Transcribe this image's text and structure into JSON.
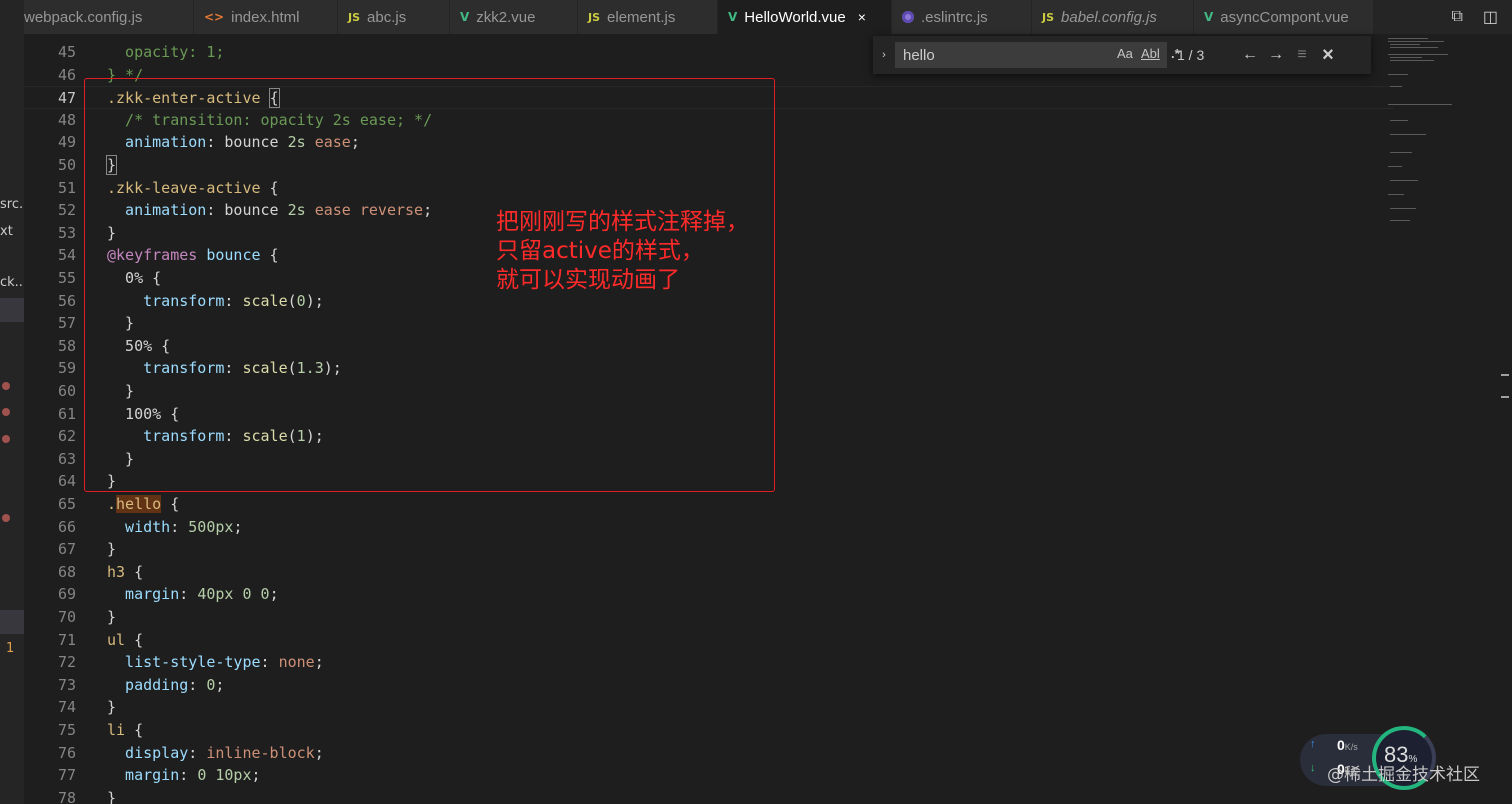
{
  "tabs": [
    {
      "label": "webpack.config.js",
      "icon": "js-icon",
      "active": false,
      "italic": false
    },
    {
      "label": "index.html",
      "icon": "html-icon",
      "active": false,
      "italic": false
    },
    {
      "label": "abc.js",
      "icon": "js-icon",
      "active": false,
      "italic": false
    },
    {
      "label": "zkk2.vue",
      "icon": "vue-icon",
      "active": false,
      "italic": false
    },
    {
      "label": "element.js",
      "icon": "js-icon",
      "active": false,
      "italic": false
    },
    {
      "label": "HelloWorld.vue",
      "icon": "vue-icon",
      "active": true,
      "italic": false
    },
    {
      "label": ".eslintrc.js",
      "icon": "eslint-icon",
      "active": false,
      "italic": false
    },
    {
      "label": "babel.config.js",
      "icon": "js-icon",
      "active": false,
      "italic": true
    },
    {
      "label": "asyncCompont.vue",
      "icon": "vue-icon",
      "active": false,
      "italic": false
    }
  ],
  "icons": {
    "js": "JS",
    "html": "<>",
    "vue": "V",
    "close": "×",
    "compare": "⧉",
    "split": "◫"
  },
  "sidebar": {
    "snippets": [
      "src...",
      "xt",
      "ck..."
    ],
    "badge": "1"
  },
  "find": {
    "query": "hello",
    "match_case": "Aa",
    "whole_word": "Abl",
    "regex": ".*",
    "count": "1 / 3",
    "prev": "←",
    "next": "→",
    "selection": "≡",
    "close": "×",
    "toggle": "›"
  },
  "annotation": {
    "lines": [
      "把刚刚写的样式注释掉，",
      "只留active的样式，",
      "就可以实现动画了"
    ],
    "color": "#ff2a2a"
  },
  "code": {
    "line_numbers": [
      "45",
      "46",
      "47",
      "48",
      "49",
      "50",
      "51",
      "52",
      "53",
      "54",
      "55",
      "56",
      "57",
      "58",
      "59",
      "60",
      "61",
      "62",
      "63",
      "64",
      "65",
      "66",
      "67",
      "68",
      "69",
      "70",
      "71",
      "72",
      "73",
      "74",
      "75",
      "76",
      "77",
      "78"
    ],
    "current_line": "47",
    "t": {
      "l45a": "  opacity: 1;",
      "l46a": "} */",
      "l47a": ".zkk-enter-active",
      "l47b": " ",
      "l47c": "{",
      "l48a": "  /* transition: opacity 2s ease; */",
      "l49a": "  animation",
      "l49b": ": bounce ",
      "l49c": "2s",
      "l49d": " ease",
      "l49e": ";",
      "l50a": "}",
      "l51a": ".zkk-leave-active",
      "l51b": " {",
      "l52a": "  animation",
      "l52b": ": bounce ",
      "l52c": "2s",
      "l52d": " ease reverse",
      "l52e": ";",
      "l53a": "}",
      "l54a": "@keyframes",
      "l54b": " bounce",
      "l54c": " {",
      "l55a": "  0%",
      "l55b": " {",
      "l56a": "    transform",
      "l56b": ": ",
      "l56c": "scale",
      "l56d": "(",
      "l56e": "0",
      "l56f": ");",
      "l57a": "  }",
      "l58a": "  50%",
      "l58b": " {",
      "l59a": "    transform",
      "l59b": ": ",
      "l59c": "scale",
      "l59d": "(",
      "l59e": "1.3",
      "l59f": ");",
      "l60a": "  }",
      "l61a": "  100%",
      "l61b": " {",
      "l62a": "    transform",
      "l62b": ": ",
      "l62c": "scale",
      "l62d": "(",
      "l62e": "1",
      "l62f": ");",
      "l63a": "  }",
      "l64a": "}",
      "l65a": ".",
      "l65b": "hello",
      "l65c": " {",
      "l66a": "  width",
      "l66b": ": ",
      "l66c": "500px",
      "l66d": ";",
      "l67a": "}",
      "l68a": "h3",
      "l68b": " {",
      "l69a": "  margin",
      "l69b": ": ",
      "l69c": "40px 0 0",
      "l69d": ";",
      "l70a": "}",
      "l71a": "ul",
      "l71b": " {",
      "l72a": "  list-style-type",
      "l72b": ": ",
      "l72c": "none",
      "l72d": ";",
      "l73a": "  padding",
      "l73b": ": ",
      "l73c": "0",
      "l73d": ";",
      "l74a": "}",
      "l75a": "li",
      "l75b": " {",
      "l76a": "  display",
      "l76b": ": ",
      "l76c": "inline-block",
      "l76d": ";",
      "l77a": "  margin",
      "l77b": ": ",
      "l77c": "0 10px",
      "l77d": ";",
      "l78a": "}"
    }
  },
  "network": {
    "up_arrow": "↑",
    "down_arrow": "↓",
    "up_speed": "0",
    "down_speed": "0",
    "unit": "K/s"
  },
  "cpu": {
    "percent": "83",
    "unit": "%"
  },
  "watermark": "@稀土掘金技术社区"
}
